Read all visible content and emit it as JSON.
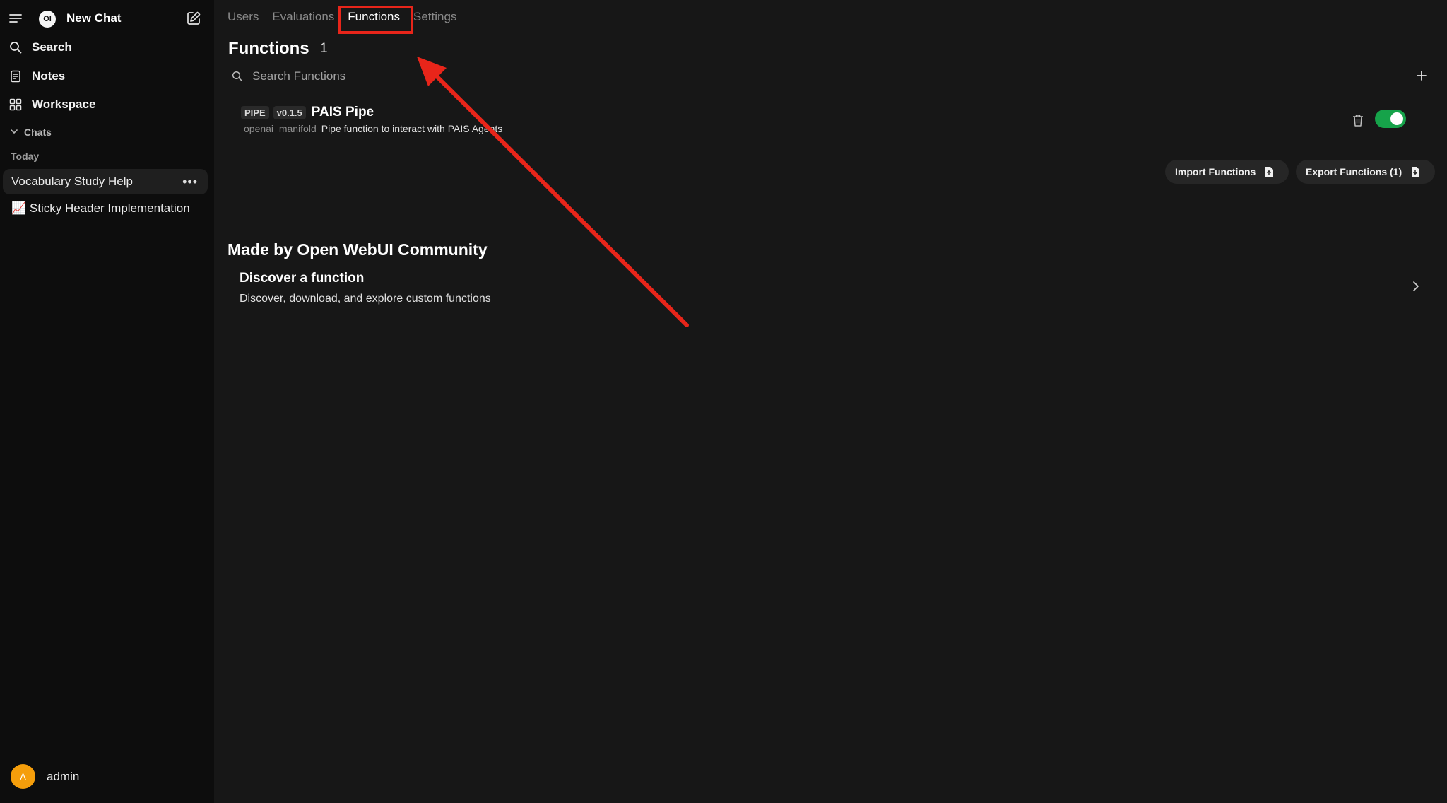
{
  "sidebar": {
    "brand_mark": "OI",
    "new_chat_label": "New Chat",
    "nav": [
      {
        "label": "Search",
        "icon": "search-icon"
      },
      {
        "label": "Notes",
        "icon": "notes-icon"
      },
      {
        "label": "Workspace",
        "icon": "workspace-icon"
      }
    ],
    "chats_section_label": "Chats",
    "today_label": "Today",
    "chats": [
      {
        "title": "Vocabulary Study Help",
        "active": true
      },
      {
        "title": "📈 Sticky Header Implementation",
        "active": false
      }
    ],
    "user": {
      "initial": "A",
      "name": "admin",
      "avatar_color": "#f59e0b"
    }
  },
  "tabs": [
    {
      "label": "Users",
      "active": false
    },
    {
      "label": "Evaluations",
      "active": false
    },
    {
      "label": "Functions",
      "active": true
    },
    {
      "label": "Settings",
      "active": false
    }
  ],
  "page": {
    "title": "Functions",
    "count": "1",
    "search_placeholder": "Search Functions"
  },
  "functions": [
    {
      "type_badge": "PIPE",
      "version_badge": "v0.1.5",
      "name": "PAIS Pipe",
      "id": "openai_manifold",
      "description": "Pipe function to interact with PAIS Agents",
      "enabled": true
    }
  ],
  "actions": {
    "import_label": "Import Functions",
    "export_label": "Export Functions (1)"
  },
  "community": {
    "title": "Made by Open WebUI Community",
    "discover_title": "Discover a function",
    "discover_desc": "Discover, download, and explore custom functions"
  },
  "colors": {
    "annotation_red": "#e8251a",
    "toggle_on": "#16a34a",
    "background": "#171717",
    "sidebar": "#0d0d0d"
  }
}
